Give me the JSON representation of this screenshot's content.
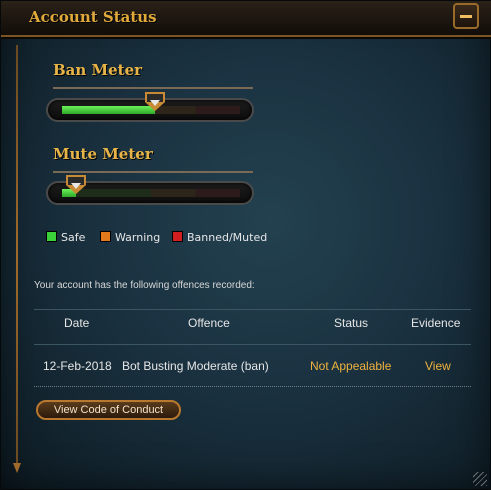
{
  "window": {
    "title": "Account Status",
    "minimize_icon": "minimize-icon"
  },
  "ban_meter": {
    "label": "Ban Meter",
    "level_fraction": 0.52
  },
  "mute_meter": {
    "label": "Mute Meter",
    "level_fraction": 0.08
  },
  "legend": [
    {
      "label": "Safe",
      "color": "#3ad13a"
    },
    {
      "label": "Warning",
      "color": "#e07a1a"
    },
    {
      "label": "Banned/Muted",
      "color": "#d11f1f"
    }
  ],
  "offences": {
    "heading": "Your account has the following offences recorded:",
    "columns": [
      "Date",
      "Offence",
      "Status",
      "Evidence"
    ],
    "rows": [
      {
        "date": "12-Feb-2018",
        "offence": "Bot Busting Moderate (ban)",
        "status": "Not Appealable",
        "evidence": "View"
      }
    ]
  },
  "buttons": {
    "code_of_conduct": "View Code of Conduct"
  },
  "colors": {
    "accent": "#e0a93a",
    "link": "#f0b23c"
  }
}
